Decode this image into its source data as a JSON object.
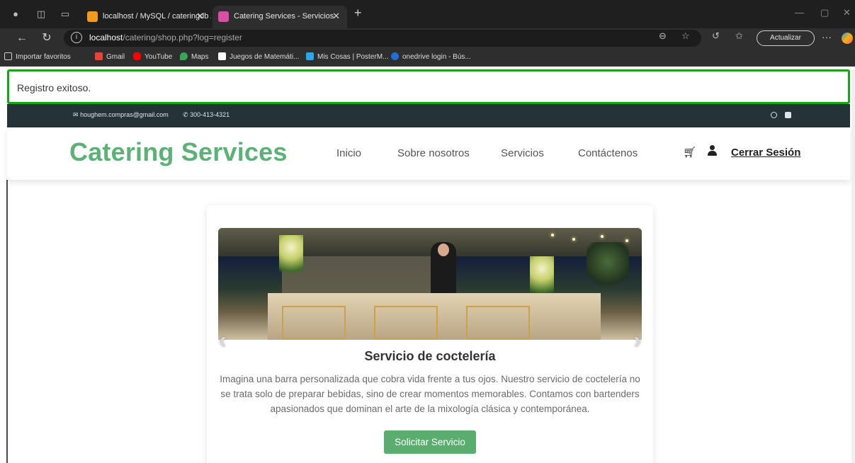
{
  "browser": {
    "tabs": [
      {
        "title": "localhost / MySQL / cateringdb / ",
        "active": false
      },
      {
        "title": "Catering Services - Servicios",
        "active": true
      }
    ],
    "new_tab_symbol": "+",
    "address": {
      "host": "localhost",
      "path": "/catering/shop.php?log=register"
    },
    "update_button": "Actualizar",
    "bookmarks": [
      "Importar favoritos",
      "Gmail",
      "YouTube",
      "Maps",
      "Juegos de Matemáti...",
      "Mis Cosas | PosterM...",
      "onedrive login - Bús..."
    ]
  },
  "alert": {
    "message": "Registro exitoso."
  },
  "topbar": {
    "email": "houghem.compras@gmail.com",
    "phone": "300-413-4321"
  },
  "header": {
    "brand": "Catering Services",
    "nav": [
      "Inicio",
      "Sobre nosotros",
      "Servicios",
      "Contáctenos"
    ],
    "logout": "Cerrar Sesión"
  },
  "service_card": {
    "title": "Servicio de coctelería",
    "description": "Imagina una barra personalizada que cobra vida frente a tus ojos. Nuestro servicio de coctelería no se trata solo de preparar bebidas, sino de crear momentos memorables. Contamos con bartenders apasionados que dominan el arte de la mixología clásica y contemporánea.",
    "button": "Solicitar Servicio",
    "prev_symbol": "‹",
    "next_symbol": "›"
  },
  "colors": {
    "brand_green": "#5cb176",
    "alert_border": "#1aa31a",
    "topbar_bg": "#253238",
    "button_green": "#5aad6f"
  }
}
